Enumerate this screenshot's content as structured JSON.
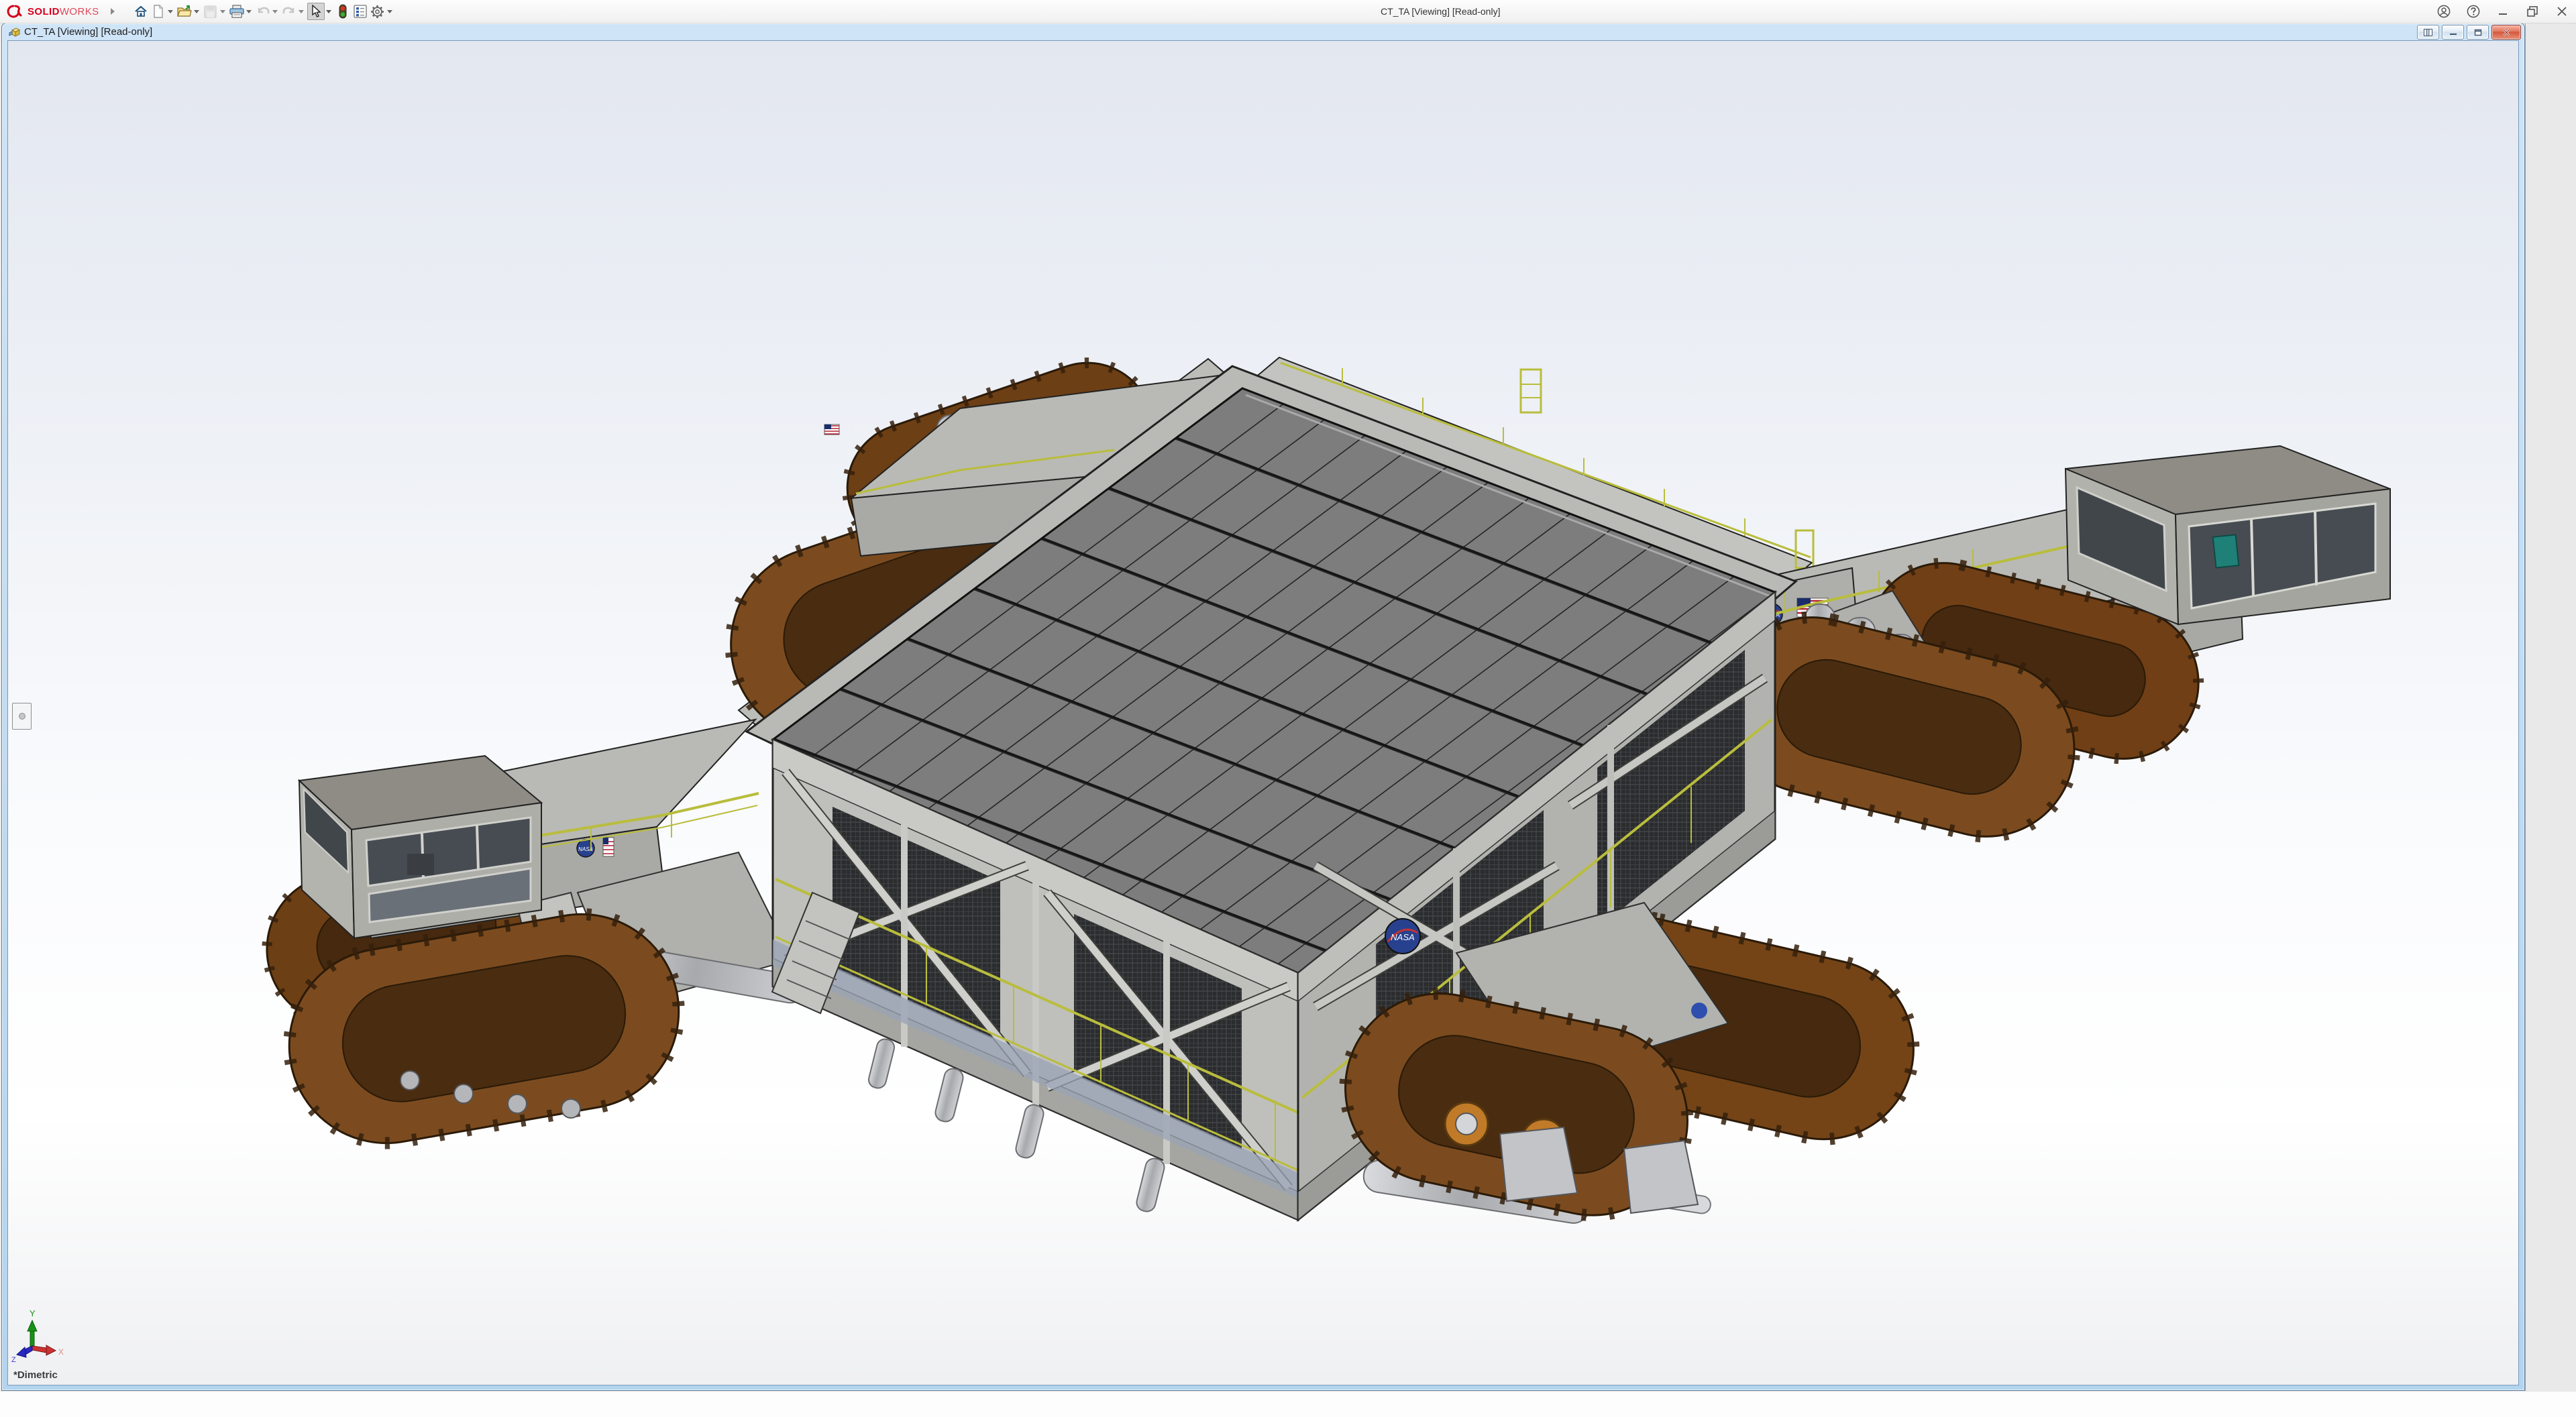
{
  "app": {
    "brand": {
      "bold": "SOLID",
      "light": "WORKS"
    },
    "window_title": "CT_TA [Viewing] [Read-only]",
    "toolbar": {
      "icons": [
        "home",
        "new-document",
        "open",
        "save",
        "print",
        "undo",
        "redo",
        "select",
        "design-checker",
        "file-properties",
        "options"
      ],
      "disabled_icons": [
        "save",
        "undo",
        "redo"
      ],
      "active_tool": "select"
    },
    "window_controls": [
      "account",
      "help",
      "minimize",
      "restore",
      "close"
    ]
  },
  "document": {
    "title": "CT_TA [Viewing] [Read-only]",
    "window_controls": [
      "featuremanager-toggle",
      "minimize",
      "restore",
      "close"
    ]
  },
  "viewport": {
    "orientation_label": "*Dimetric",
    "triad": {
      "x_label": "X",
      "y_label": "Y",
      "z_label": "Z"
    },
    "nasa_logo_text": "NASA"
  },
  "colors": {
    "brand_red": "#d6001c",
    "doc_titlebar_blue": "#c2dbf2",
    "window_border_blue": "#b3d4ef",
    "close_button_red": "#d4573e",
    "viewport_top": "#e3e7f0",
    "viewport_bottom": "#eff0f2",
    "deck_gray": "#7d7d7d",
    "structure_gray": "#b9bab5",
    "truss_light_gray": "#c9cac5",
    "track_brown": "#7b4b1f",
    "track_brown_dark": "#4a2c10",
    "railing_yellow": "#b9bd3c",
    "nasa_blue": "#28418f",
    "flag_red": "#b22234",
    "triad_x_red": "#cc3333",
    "triad_y_green": "#179217",
    "triad_z_blue": "#3333cc"
  }
}
